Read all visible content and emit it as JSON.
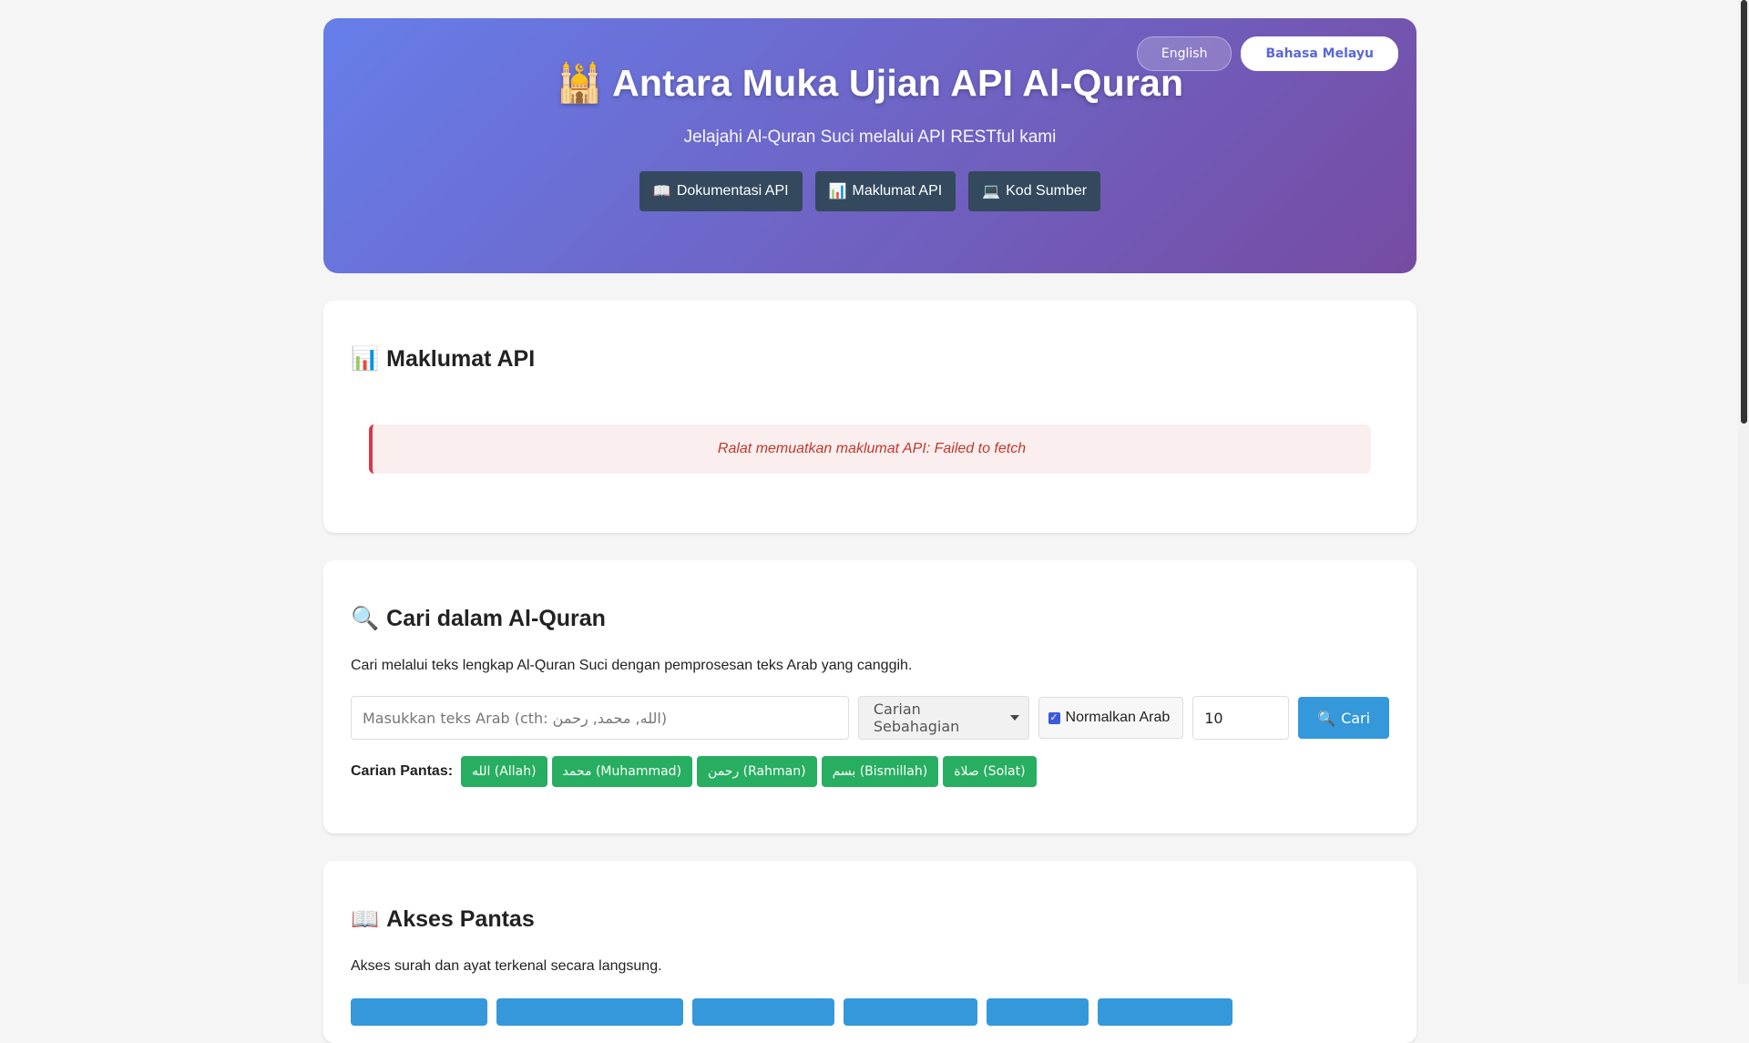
{
  "lang": {
    "english": "English",
    "malay": "Bahasa Melayu"
  },
  "hero": {
    "icon": "🕌",
    "title": "Antara Muka Ujian API Al-Quran",
    "subtitle": "Jelajahi Al-Quran Suci melalui API RESTful kami",
    "links": [
      {
        "icon": "📖",
        "label": "Dokumentasi API"
      },
      {
        "icon": "📊",
        "label": "Maklumat API"
      },
      {
        "icon": "💻",
        "label": "Kod Sumber"
      }
    ]
  },
  "info": {
    "icon": "📊",
    "title": "Maklumat API",
    "error": "Ralat memuatkan maklumat API: Failed to fetch"
  },
  "search": {
    "icon": "🔍",
    "title": "Cari dalam Al-Quran",
    "description": "Cari melalui teks lengkap Al-Quran Suci dengan pemprosesan teks Arab yang canggih.",
    "placeholder": "Masukkan teks Arab (cth: الله, محمد, رحمن)",
    "mode": "Carian Sebahagian",
    "normalize_label": "Normalkan Arab",
    "normalize_checked": true,
    "limit": "10",
    "button_icon": "🔍",
    "button_label": "Cari",
    "quick_label": "Carian Pantas:",
    "quick_items": [
      "الله (Allah)",
      "محمد (Muhammad)",
      "رحمن (Rahman)",
      "بسم (Bismillah)",
      "صلاة (Solat)"
    ]
  },
  "access": {
    "icon": "📖",
    "title": "Akses Pantas",
    "description": "Akses surah dan ayat terkenal secara langsung."
  },
  "colors": {
    "hero_start": "#667eea",
    "hero_end": "#764ba2",
    "link_bg": "#34495e",
    "primary": "#3498db",
    "success": "#27ae60",
    "error": "#c0392b"
  }
}
